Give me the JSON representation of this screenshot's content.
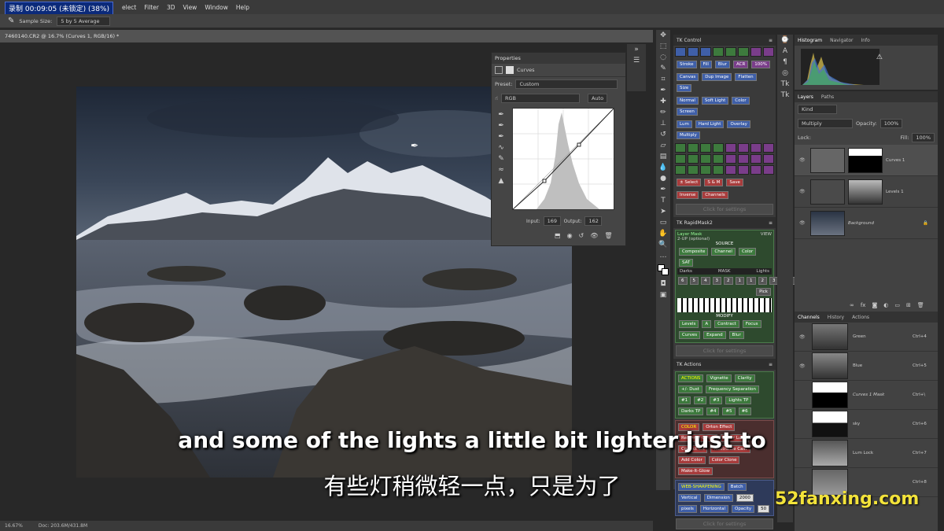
{
  "menubar": {
    "rec_badge": "录制 00:09:05 (未锁定) (38%)",
    "items": [
      "elect",
      "Filter",
      "3D",
      "View",
      "Window",
      "Help"
    ]
  },
  "options": {
    "sample_size_label": "Sample Size:",
    "sample_size_value": "5 by 5 Average"
  },
  "document": {
    "tab_title": "7460140.CR2 @ 16.7% (Curves 1, RGB/16) *"
  },
  "status": {
    "zoom": "16.67%",
    "doc": "Doc: 203.6M/431.8M"
  },
  "properties": {
    "tab": "Properties",
    "adjustment": "Curves",
    "preset_label": "Preset:",
    "preset_value": "Custom",
    "channel_value": "RGB",
    "auto_label": "Auto",
    "input_label": "Input:",
    "input_value": "169",
    "output_label": "Output:",
    "output_value": "162"
  },
  "tk_control": {
    "title": "TK Control",
    "row1": [
      "Stroke",
      "Fill",
      "Blur",
      "ACR",
      "100%"
    ],
    "row2": [
      "Canvas",
      "Dup Image",
      "Flatten",
      "Size"
    ],
    "row3": [
      "Normal",
      "Soft Light",
      "Color",
      "Screen"
    ],
    "row4": [
      "Lum",
      "Hard Light",
      "Overlay",
      "Multiply"
    ],
    "row5": [
      "± Select",
      "S & M",
      "Save"
    ],
    "row6": [
      "Inverse",
      "Channels"
    ],
    "click": "Click for settings"
  },
  "tk_rapidmask": {
    "title": "TK RapidMask2",
    "layer_mask": "Layer Mask",
    "view": "VIEW",
    "two_up": "2-UP (optional)",
    "source": "SOURCE",
    "source_btns": [
      "Composite",
      "Channel",
      "Color",
      "SAT"
    ],
    "mask": "MASK",
    "darks": "Darks",
    "lights": "Lights",
    "zone_nums": [
      "6",
      "5",
      "4",
      "3",
      "2",
      "1",
      "1",
      "2",
      "3",
      "4",
      "5",
      "6"
    ],
    "pick": "Pick",
    "modify": "MODIFY",
    "mod_row1": [
      "Levels",
      "A",
      "Contract",
      "Focus"
    ],
    "mod_row2": [
      "Curves",
      "Expand",
      "Blur"
    ],
    "click": "Click for settings"
  },
  "tk_actions": {
    "title": "TK Actions",
    "actions_label": "ACTIONS",
    "actions_btns": [
      "Vignette",
      "Clarity",
      "+/- Dust",
      "Frequency Separation",
      "#1",
      "#2",
      "#3",
      "Lights TP",
      "Darks TP",
      "#4",
      "#5",
      "#6"
    ],
    "color_label": "COLOR",
    "color_btns": [
      "Orton Effect",
      "Restored Orton",
      "Color Lum",
      "Correct CA",
      "Neutralize Cast",
      "Add Color",
      "Color Clone",
      "Make-It-Glow"
    ],
    "web_label": "WEB-SHARPENING",
    "web_btns": [
      "Batch",
      "Vertical",
      "Dimension",
      "2000",
      "pixels",
      "Horizontal"
    ],
    "opacity_label": "Opacity",
    "opacity_value": "50",
    "click": "Click for settings"
  },
  "histogram": {
    "tabs": [
      "Histogram",
      "Navigator",
      "Info"
    ]
  },
  "layers": {
    "tabs": [
      "Layers",
      "Paths"
    ],
    "kind": "Kind",
    "blend": "Multiply",
    "opacity_label": "Opacity:",
    "opacity_value": "100%",
    "lock_label": "Lock:",
    "fill_label": "Fill:",
    "fill_value": "100%",
    "items": [
      {
        "name": "Curves 1"
      },
      {
        "name": "Levels 1"
      },
      {
        "name": "Background"
      }
    ]
  },
  "channels": {
    "tabs": [
      "Channels",
      "History",
      "Actions"
    ],
    "items": [
      {
        "name": "Green",
        "shortcut": "Ctrl+4"
      },
      {
        "name": "Blue",
        "shortcut": "Ctrl+5"
      },
      {
        "name": "Curves 1 Mask",
        "shortcut": "Ctrl+\\"
      },
      {
        "name": "sky",
        "shortcut": "Ctrl+6"
      },
      {
        "name": "Lum Lock",
        "shortcut": "Ctrl+7"
      },
      {
        "name": "",
        "shortcut": "Ctrl+8"
      }
    ]
  },
  "subtitles": {
    "en": "and some of the lights a little bit lighter just to",
    "zh": "有些灯稍微轻一点，只是为了"
  },
  "watermark": "52fanxing.com"
}
